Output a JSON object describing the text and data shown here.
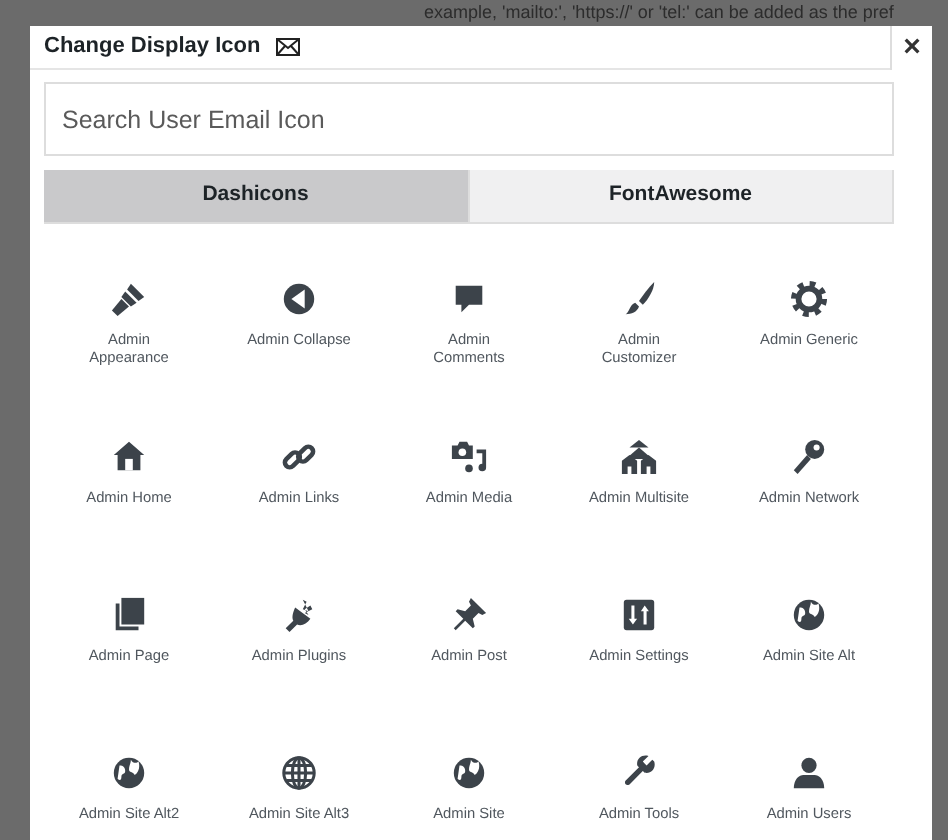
{
  "backdrop_text": "example, 'mailto:', 'https://' or 'tel:' can be added as the pref",
  "dialog": {
    "title": "Change Display Icon",
    "close": "×"
  },
  "search": {
    "placeholder": "Search User Email Icon"
  },
  "tabs": [
    {
      "label": "Dashicons",
      "selected": true
    },
    {
      "label": "FontAwesome",
      "selected": false
    }
  ],
  "icons": [
    {
      "label": "Admin Appearance"
    },
    {
      "label": "Admin Collapse"
    },
    {
      "label": "Admin Comments"
    },
    {
      "label": "Admin Customizer"
    },
    {
      "label": "Admin Generic"
    },
    {
      "label": "Admin Home"
    },
    {
      "label": "Admin Links"
    },
    {
      "label": "Admin Media"
    },
    {
      "label": "Admin Multisite"
    },
    {
      "label": "Admin Network"
    },
    {
      "label": "Admin Page"
    },
    {
      "label": "Admin Plugins"
    },
    {
      "label": "Admin Post"
    },
    {
      "label": "Admin Settings"
    },
    {
      "label": "Admin Site Alt"
    },
    {
      "label": "Admin Site Alt2"
    },
    {
      "label": "Admin Site Alt3"
    },
    {
      "label": "Admin Site"
    },
    {
      "label": "Admin Tools"
    },
    {
      "label": "Admin Users"
    }
  ]
}
